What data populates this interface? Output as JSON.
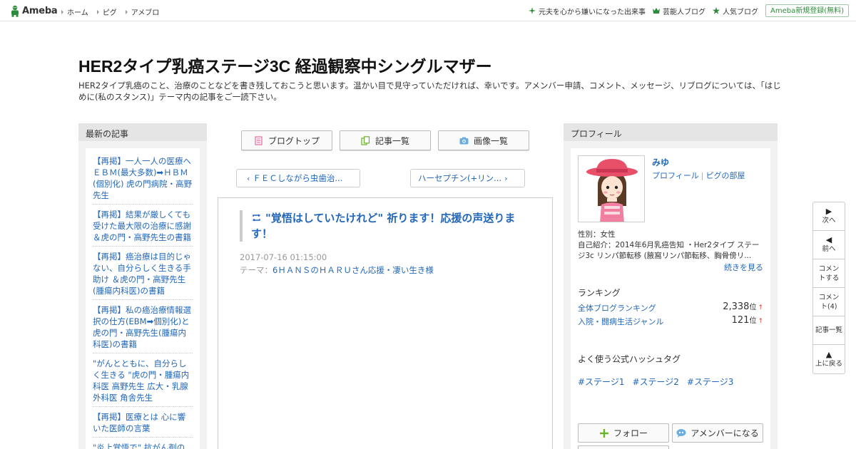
{
  "topbar": {
    "logo_text": "Ameba",
    "nav": [
      "ホーム",
      "ピグ",
      "アメブロ"
    ],
    "links": [
      {
        "label": "元夫を心から嫌いになった出来事",
        "icon": "sparkle-icon"
      },
      {
        "label": "芸能人ブログ",
        "icon": "crown-icon"
      },
      {
        "label": "人気ブログ",
        "icon": "star-icon"
      }
    ],
    "register_label": "Ameba新規登録(無料)"
  },
  "header": {
    "title": "HER2タイプ乳癌ステージ3C 経過観察中シングルマザー",
    "description": "HER2タイプ乳癌のこと、治療のことなどを書き残しておこうと思います。温かい目で見守っていただければ、幸いです。アメンバー申請、コメント、メッセージ、リブログについては、「はじめに(私のスタンス)」テーマ内の記事をご一読下さい。"
  },
  "left_sidebar": {
    "heading": "最新の記事",
    "items": [
      "【再掲】一人一人の医療へ ＥＢＭ(最大多数)➡ＨＢＭ(個別化) 虎の門病院・高野先生",
      "【再掲】結果が厳しくても受けた最大限の治療に感謝 ＆虎の門・高野先生の書籍",
      "【再掲】癌治療は目的じゃない、自分らしく生きる手助け ＆虎の門・高野先生(腫瘍内科医)の書籍",
      "【再掲】私の癌治療情報選択の仕方(EBM➡個別化)と虎の門・高野先生(腫瘍内科医)の書籍",
      "\"がんとともに、自分らしく生きる \"虎の門・腫瘍内科医 高野先生 広大・乳腺外科医 角舎先生",
      "【再掲】医療とは 心に響いた医師の言葉",
      "\"炎上覚悟で\" 抗がん剤の"
    ]
  },
  "tabs": [
    {
      "label": "ブログトップ",
      "icon": "document-icon"
    },
    {
      "label": "記事一覧",
      "icon": "copy-icon"
    },
    {
      "label": "画像一覧",
      "icon": "camera-icon"
    }
  ],
  "pager": {
    "prev": "ＦＥＣしながら虫歯治...",
    "next": "ハーセプチン(+リン..."
  },
  "entry": {
    "title": "\"覚悟はしていたけれど\" 祈ります！応援の声送ります！",
    "date": "2017-07-16 01:15:00",
    "theme_label": "テーマ：",
    "theme": "6ＨＡＮＳのＨＡＲＵさん応援・凄い生き様"
  },
  "profile": {
    "heading": "プロフィール",
    "name": "みゆ",
    "link_profile": "プロフィール",
    "link_pig": "ピグの部屋",
    "gender": "性別：女性",
    "intro": "自己紹介：2014年6月乳癌告知 ・Her2タイプ ステージ3c リンパ節転移 (腋窩リンパ節転移、胸骨傍リ...",
    "more": "続きを見る",
    "ranking_heading": "ランキング",
    "rankings": [
      {
        "label": "全体ブログランキング",
        "value": "2,338",
        "unit": "位",
        "trend": "↑"
      },
      {
        "label": "入院・闘病生活ジャンル",
        "value": "121",
        "unit": "位",
        "trend": "↑"
      }
    ],
    "hashtag_heading": "よく使う公式ハッシュタグ",
    "hashtags": [
      "#ステージ1",
      "#ステージ2",
      "#ステージ3"
    ],
    "follow_label": "フォロー",
    "member_label": "アメンバーになる"
  },
  "floatnav": [
    {
      "arrow": "▶",
      "label": "次へ"
    },
    {
      "arrow": "◀",
      "label": "前へ"
    },
    {
      "arrow": "",
      "label": "コメントする"
    },
    {
      "arrow": "",
      "label": "コメント(4)"
    },
    {
      "arrow": "",
      "label": "記事一覧"
    },
    {
      "arrow": "▲",
      "label": "上に戻る"
    }
  ],
  "colors": {
    "link": "#2267b9",
    "brand_green": "#2d8c3c",
    "sidebar_bg": "#f2f2f2"
  }
}
